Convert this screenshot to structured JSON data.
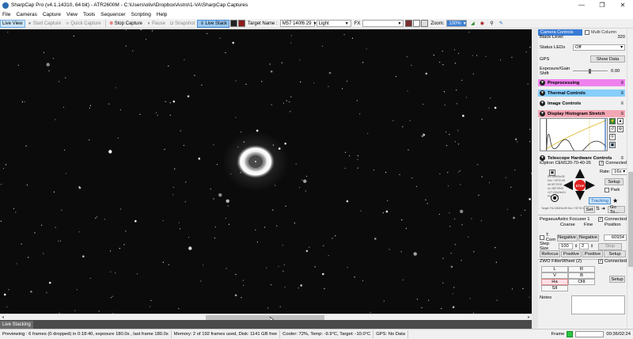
{
  "window": {
    "title": "SharpCap Pro (v4.1.14310, 64 bit) - ATR2600M - C:\\Users\\olivi\\Dropbox\\Astro\\1-VA\\SharpCap Captures",
    "minimize": "—",
    "maximize": "❐",
    "close": "✕"
  },
  "menu": [
    "File",
    "Cameras",
    "Capture",
    "View",
    "Tools",
    "Sequencer",
    "Scripting",
    "Help"
  ],
  "toolbar": {
    "live_view": "Live View",
    "start_capture": "Start Capture",
    "quick_capture": "Quick Capture",
    "stop_capture": "Stop Capture",
    "pause": "Pause",
    "snapshot": "Snapshot",
    "live_stack": "Live Stack",
    "target_name_label": "Target Name :",
    "target_name": "M57 140f6 29",
    "frame_type": "Light",
    "fx_label": "FX",
    "fx_value": "",
    "zoom_label": "Zoom:",
    "zoom_value": "100%"
  },
  "live_stacking_tab": "Live Stacking",
  "status": {
    "preview": "Previewing : 6 frames (0 dropped) in 0:18:40, exposure 180.0s , last frame 180.0s",
    "memory": "Memory: 2 of 192 frames used, Disk: 1141 GB free",
    "cooler": "Cooler: 72%, Temp: -9.9°C, Target: -10.0°C",
    "gps": "GPS: No Data",
    "frame_label": "Frame",
    "time": "00:36/02:24"
  },
  "panel": {
    "tab_camera": "Camera Controls",
    "tab_multi": "Multi Column",
    "black_level_label": "Black Level",
    "black_level_value": "320",
    "status_leds_label": "Status LEDs",
    "status_leds_value": "Off",
    "gps_label": "GPS",
    "show_data": "Show Data",
    "exposure_gain_label": "Exposure/Gain Shift",
    "exposure_gain_value": "0.00",
    "sections": {
      "preprocessing": "Preprocessing",
      "thermal": "Thermal Controls",
      "image": "Image Controls",
      "histogram": "Display Histogram Stretch",
      "telescope": "Telescope Hardware Controls"
    },
    "section_colors": {
      "preprocessing": "#ee82ee",
      "thermal": "#87cefa",
      "image": "#f0f0f0",
      "histogram": "#f4a6b4",
      "telescope": "#f0f0f0"
    },
    "mount": {
      "name": "iOptron CEM120-70-40-26",
      "connected_label": "Connected",
      "rate_label": "Rate:",
      "rate_value": "16x",
      "setup": "Setup",
      "park": "Park",
      "stop": "STOP",
      "tracking": "Tracking",
      "goto": "Go To...",
      "set": "Set",
      "coords": [
        "RA  18h53m35",
        "Dec +33°01'45",
        "Alt  55°23'00",
        "Az  285°39'00",
        "LST  20h15m01",
        "Pier  East"
      ],
      "target_line": "Target: RA 18h53m35 Dec +33°01'45"
    },
    "focuser": {
      "name": "PegasusAstro Focuser 1",
      "connected_label": "Connected",
      "coarse": "Coarse",
      "fine": "Fine",
      "position": "Position",
      "t_comp": "T. Com",
      "negative": "Negative",
      "positive": "Positive",
      "position_value": "60934",
      "step_size_label": "Step Size",
      "step_size_value": "100",
      "fine_step_value": "2",
      "stop": "Stop",
      "refocus": "Refocus",
      "setup": "Setup"
    },
    "filterwheel": {
      "name": "ZWO FilterWheel (2)",
      "connected_label": "Connected",
      "filters": [
        "L",
        "R",
        "V",
        "B",
        "Ha",
        "OIII",
        "SII"
      ],
      "active": "Ha",
      "setup": "Setup"
    },
    "notes_label": "Notes"
  }
}
